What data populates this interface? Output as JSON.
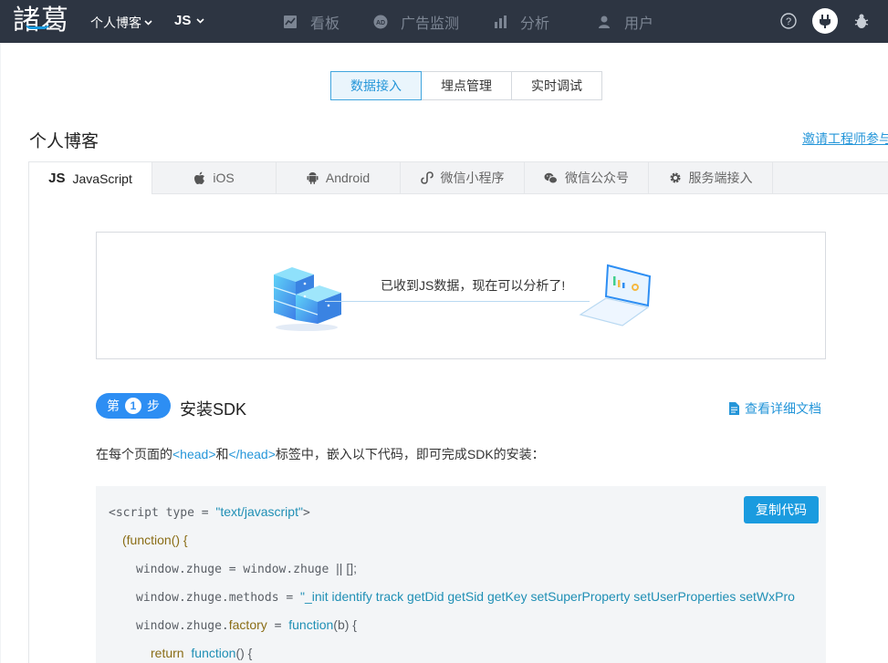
{
  "topbar": {
    "logo": "諸葛",
    "project_selector": "个人博客",
    "platform_selector": "JS",
    "nav": [
      {
        "label": "看板",
        "icon": "line-chart-icon"
      },
      {
        "label": "广告监测",
        "icon": "ad-icon"
      },
      {
        "label": "分析",
        "icon": "bar-chart-icon"
      },
      {
        "label": "用户",
        "icon": "user-icon"
      }
    ],
    "right_icons": [
      "help-icon",
      "plug-icon",
      "bug-icon"
    ]
  },
  "segmented": {
    "items": [
      "数据接入",
      "埋点管理",
      "实时调试"
    ],
    "active": "数据接入"
  },
  "project_title": "个人博客",
  "invite_link": "邀请工程师参与",
  "platform_tabs": [
    {
      "label": "JavaScript",
      "icon": "JS"
    },
    {
      "label": "iOS",
      "icon": "apple-icon"
    },
    {
      "label": "Android",
      "icon": "android-icon"
    },
    {
      "label": "微信小程序",
      "icon": "mini-program-icon"
    },
    {
      "label": "微信公众号",
      "icon": "wechat-icon"
    },
    {
      "label": "服务端接入",
      "icon": "gear-icon"
    }
  ],
  "status": {
    "message": "已收到JS数据，现在可以分析了!"
  },
  "step": {
    "prefix": "第",
    "number": "1",
    "suffix": "步",
    "title": "安装SDK",
    "doc_link": "查看详细文档"
  },
  "instruction": {
    "before": "在每个页面的",
    "tag_open": "<head>",
    "and": "和",
    "tag_close": "</head>",
    "after": "标签中，嵌入以下代码，即可完成SDK的安装："
  },
  "code": {
    "copy_label": "复制代码",
    "line1_a": "<script type = ",
    "line1_b": "\"text/javascript\"",
    "line1_c": ">",
    "line2": "(function() {",
    "line3_a": "window.zhuge = window.zhuge ",
    "line3_b": "|| [];",
    "line4_a": "window.zhuge.methods = ",
    "line4_b": "\"_init identify track getDid getSid getKey setSuperProperty setUserProperties setWxPro",
    "line5_a": "window.zhuge.",
    "line5_b": "factory",
    "line5_c": " = ",
    "line5_d": "function",
    "line5_e": "(b) {",
    "line6_a": "return",
    "line6_b": "function",
    "line6_c": "() {"
  }
}
